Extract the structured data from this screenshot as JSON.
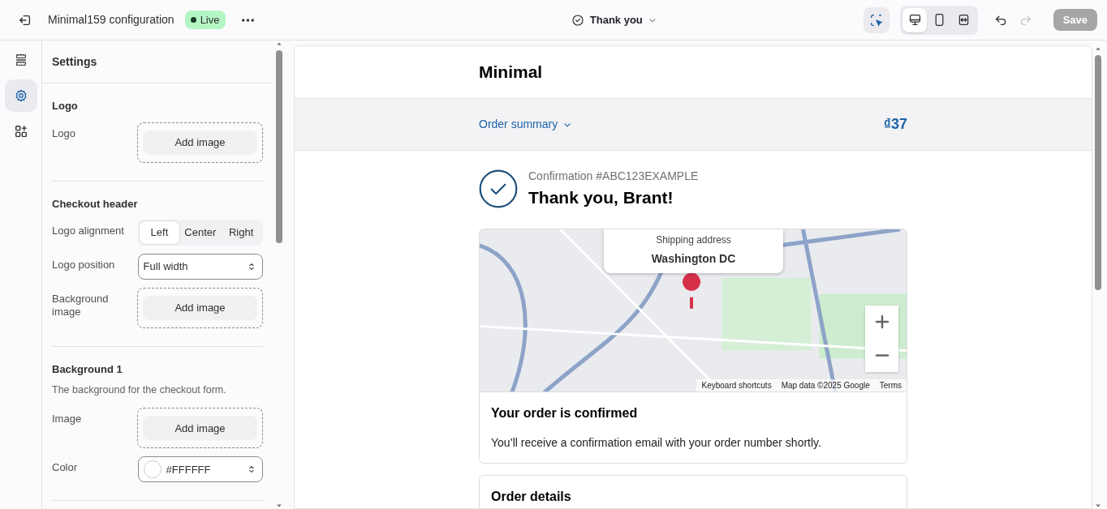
{
  "topbar": {
    "title": "Minimal159 configuration",
    "status": {
      "label": "Live",
      "color": "#b4f5c4"
    },
    "page": "Thank you",
    "view_modes": [
      {
        "kind": "desktop",
        "selected": true
      },
      {
        "kind": "mobile",
        "selected": false
      },
      {
        "kind": "fullscreen",
        "selected": false
      }
    ],
    "inspector": {
      "selected": true
    },
    "undo": {
      "disabled": false
    },
    "redo": {
      "disabled": true
    },
    "save": {
      "label": "Save",
      "disabled": true
    }
  },
  "rail": [
    {
      "kind": "sections",
      "selected": false
    },
    {
      "kind": "settings",
      "selected": true
    },
    {
      "kind": "apps",
      "selected": false
    }
  ],
  "settings": {
    "title": "Settings",
    "sections": [
      {
        "title": "Logo",
        "fields": [
          {
            "kind": "image",
            "label": "Logo",
            "button": "Add image"
          }
        ]
      },
      {
        "title": "Checkout header",
        "fields": [
          {
            "kind": "segmented",
            "label": "Logo alignment",
            "options": [
              {
                "label": "Left",
                "selected": true
              },
              {
                "label": "Center",
                "selected": false
              },
              {
                "label": "Right",
                "selected": false
              }
            ]
          },
          {
            "kind": "select",
            "label": "Logo position",
            "value": "Full width"
          },
          {
            "kind": "image",
            "label": "Background image",
            "button": "Add image"
          }
        ]
      },
      {
        "title": "Background 1",
        "description": "The background for the checkout form.",
        "fields": [
          {
            "kind": "image",
            "label": "Image",
            "button": "Add image"
          },
          {
            "kind": "color",
            "label": "Color",
            "value": "#FFFFFF",
            "color": "#ffffff"
          }
        ]
      }
    ]
  },
  "preview": {
    "shop_name": "Minimal",
    "order_summary": {
      "label": "Order summary",
      "total": "₫37"
    },
    "confirmation": {
      "number": "Confirmation #ABC123EXAMPLE",
      "heading": "Thank you, Brant!"
    },
    "map": {
      "overlay_label": "Shipping address",
      "overlay_value": "Washington DC",
      "attribution": [
        "Keyboard shortcuts",
        "Map data ©2025 Google",
        "Terms"
      ]
    },
    "cards": [
      {
        "title": "Your order is confirmed",
        "text": "You’ll receive a confirmation email with your order number shortly."
      },
      {
        "title": "Order details"
      }
    ]
  }
}
